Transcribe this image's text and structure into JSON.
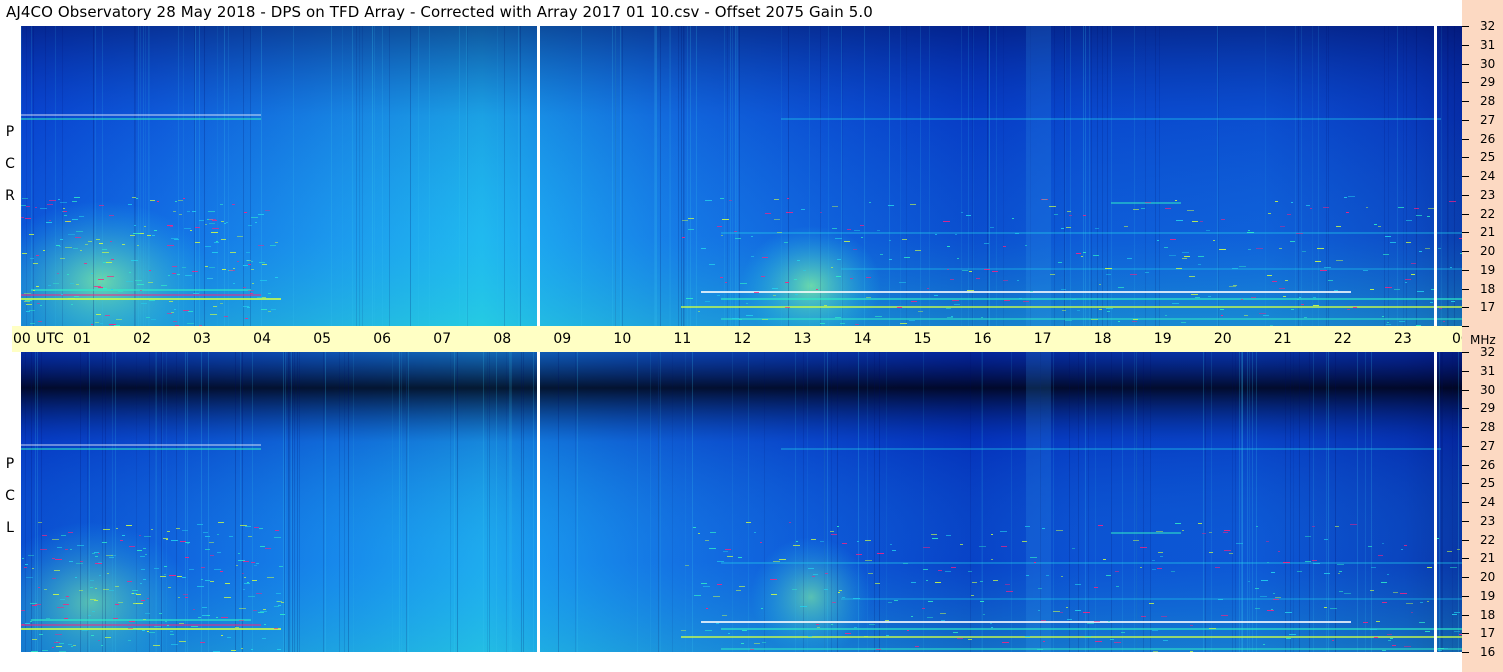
{
  "header": {
    "title": "AJ4CO Observatory  28 May 2018  -  DPS on TFD Array  -  Corrected with Array 2017 01 10.csv  -  Offset 2075  Gain 5.0"
  },
  "panels": [
    {
      "id": "rcp",
      "letters": [
        "R",
        "C",
        "P"
      ]
    },
    {
      "id": "lcp",
      "letters": [
        "L",
        "C",
        "P"
      ]
    }
  ],
  "chart_data": {
    "type": "heatmap",
    "title": "AJ4CO Observatory  28 May 2018  -  DPS on TFD Array  -  Corrected with Array 2017 01 10.csv  -  Offset 2075  Gain 5.0",
    "x_axis": {
      "unit_label": "UTC",
      "ticks": [
        "00",
        "01",
        "02",
        "03",
        "04",
        "05",
        "06",
        "07",
        "08",
        "09",
        "10",
        "11",
        "12",
        "13",
        "14",
        "15",
        "16",
        "17",
        "18",
        "19",
        "20",
        "21",
        "22",
        "23",
        "00"
      ],
      "range": [
        0,
        24
      ]
    },
    "y_axis": {
      "unit_label": "MHz",
      "ticks": [
        "16",
        "17",
        "18",
        "19",
        "20",
        "21",
        "22",
        "23",
        "24",
        "25",
        "26",
        "27",
        "28",
        "29",
        "30",
        "31",
        "32"
      ],
      "range": [
        16,
        32
      ]
    },
    "series": [
      {
        "name": "R C P"
      },
      {
        "name": "L C P"
      }
    ],
    "colormap": [
      "#000033",
      "#000a8c",
      "#0040e0",
      "#1a8cf0",
      "#22d2ee",
      "#2ff0c8",
      "#cfff45",
      "#ff2080",
      "#ffffff"
    ],
    "data_gaps_utc": [
      8.6,
      23.6
    ]
  }
}
